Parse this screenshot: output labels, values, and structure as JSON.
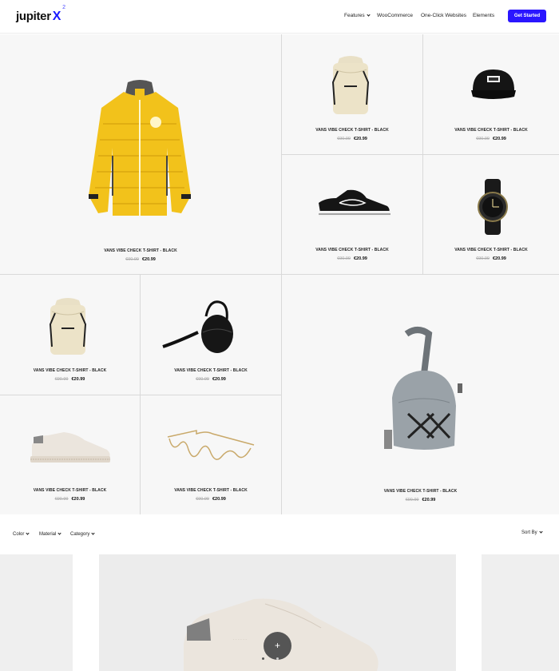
{
  "header": {
    "logo_text": "jupiter",
    "logo_x": "X",
    "logo_sup": "2",
    "nav": [
      {
        "label": "Features",
        "dropdown": true
      },
      {
        "label": "WooCommerce",
        "dropdown": false
      },
      {
        "label": "One-Click Websites",
        "dropdown": false
      },
      {
        "label": "Elements",
        "dropdown": false
      }
    ],
    "cta_label": "Get Started",
    "accent_color": "#2a16ff"
  },
  "products": [
    {
      "name": "VANS VIBE CHECK T-SHIRT - BLACK",
      "old_price": "€90.99",
      "price": "€20.99",
      "image": "yellow-puffer-jacket"
    },
    {
      "name": "VANS VIBE CHECK T-SHIRT - BLACK",
      "old_price": "€90.99",
      "price": "€20.99",
      "image": "cream-backpack"
    },
    {
      "name": "VANS VIBE CHECK T-SHIRT - BLACK",
      "old_price": "€90.99",
      "price": "€20.99",
      "image": "black-cap"
    },
    {
      "name": "VANS VIBE CHECK T-SHIRT - BLACK",
      "old_price": "€90.99",
      "price": "€20.99",
      "image": "black-sneaker"
    },
    {
      "name": "VANS VIBE CHECK T-SHIRT - BLACK",
      "old_price": "€90.99",
      "price": "€20.99",
      "image": "black-watch"
    },
    {
      "name": "VANS VIBE CHECK T-SHIRT - BLACK",
      "old_price": "€90.99",
      "price": "€20.99",
      "image": "cream-backpack"
    },
    {
      "name": "VANS VIBE CHECK T-SHIRT - BLACK",
      "old_price": "€90.99",
      "price": "€20.99",
      "image": "black-leather-bag"
    },
    {
      "name": "VANS VIBE CHECK T-SHIRT - BLACK",
      "old_price": "€90.99",
      "price": "€20.99",
      "image": "grey-sling-bag"
    },
    {
      "name": "VANS VIBE CHECK T-SHIRT - BLACK",
      "old_price": "€90.99",
      "price": "€20.99",
      "image": "white-sneaker"
    },
    {
      "name": "VANS VIBE CHECK T-SHIRT - BLACK",
      "old_price": "€90.99",
      "price": "€20.99",
      "image": "gold-chain-glasses"
    }
  ],
  "filters": {
    "items": [
      "Color",
      "Material",
      "Category"
    ],
    "sort_label": "Sort By"
  },
  "carousel": {
    "add_button": "+"
  }
}
